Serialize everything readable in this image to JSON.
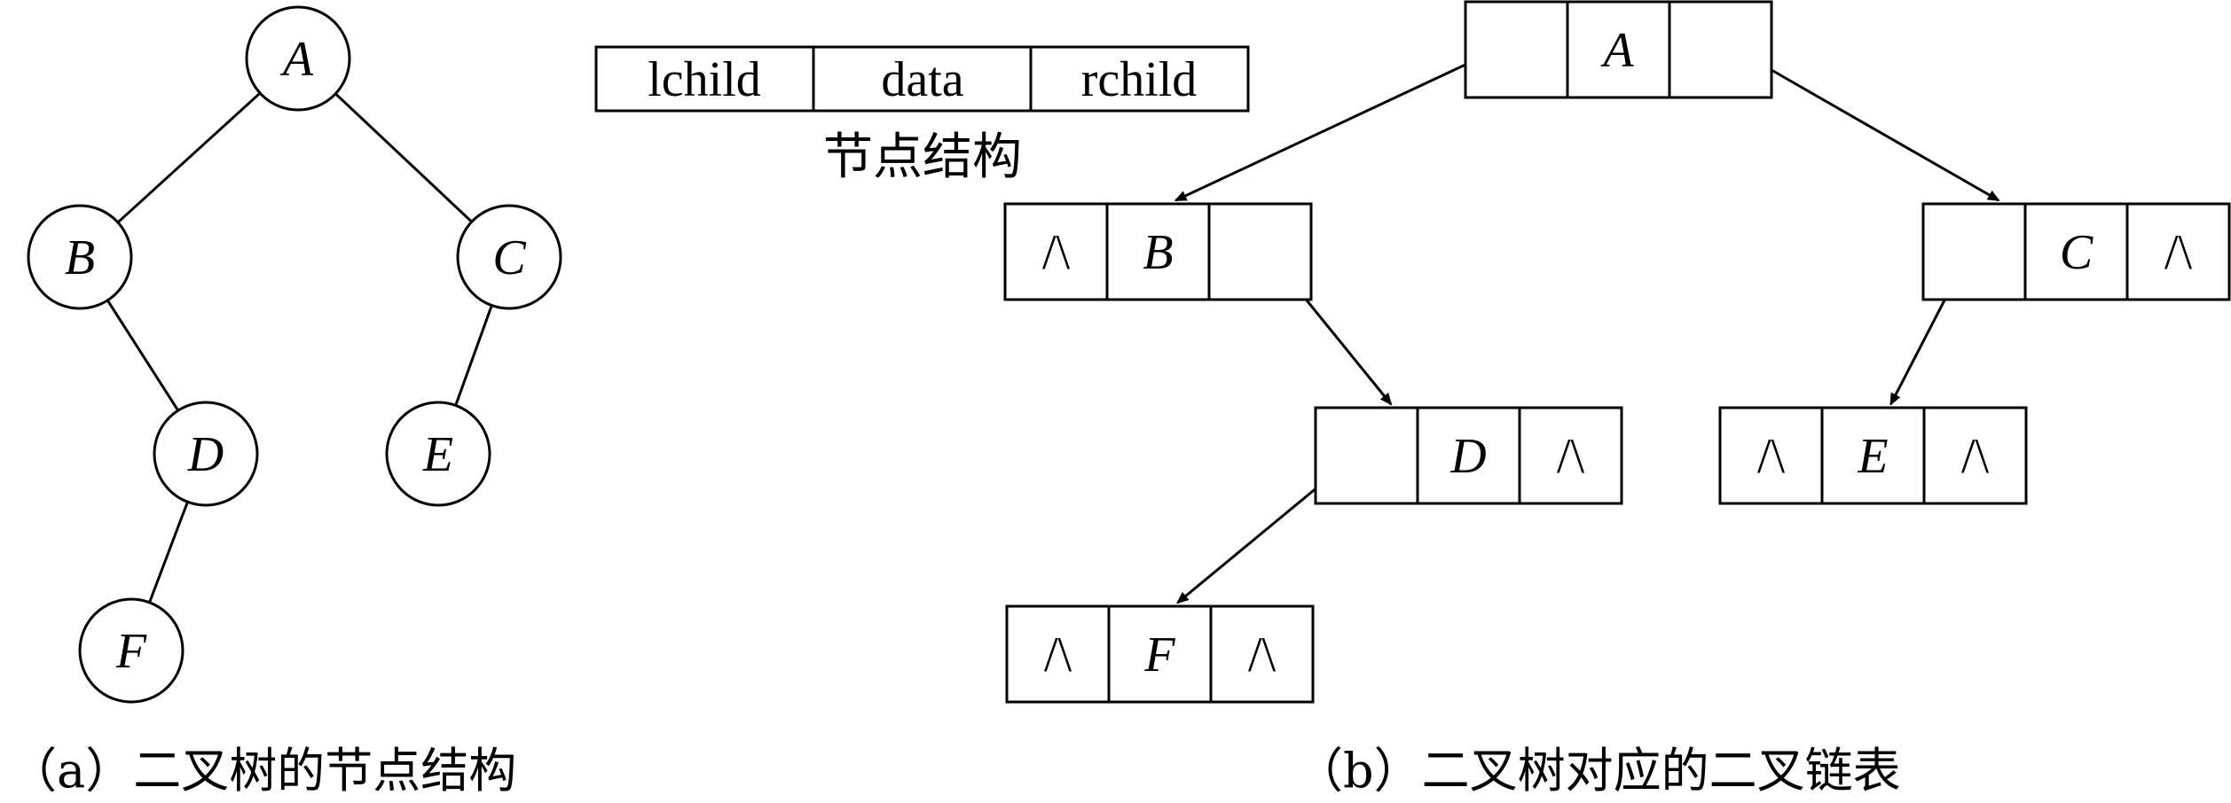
{
  "tree": {
    "nodes": [
      {
        "id": "A",
        "label": "A"
      },
      {
        "id": "B",
        "label": "B"
      },
      {
        "id": "C",
        "label": "C"
      },
      {
        "id": "D",
        "label": "D"
      },
      {
        "id": "E",
        "label": "E"
      },
      {
        "id": "F",
        "label": "F"
      }
    ],
    "edges": [
      [
        "A",
        "B"
      ],
      [
        "A",
        "C"
      ],
      [
        "B",
        "D"
      ],
      [
        "C",
        "E"
      ],
      [
        "D",
        "F"
      ]
    ]
  },
  "node_structure": {
    "fields": [
      "lchild",
      "data",
      "rchild"
    ],
    "label": "节点结构"
  },
  "linked_list": {
    "nodes": [
      {
        "id": "A",
        "left": "",
        "data": "A",
        "right": ""
      },
      {
        "id": "B",
        "left": "/\\",
        "data": "B",
        "right": ""
      },
      {
        "id": "C",
        "left": "",
        "data": "C",
        "right": "/\\"
      },
      {
        "id": "D",
        "left": "",
        "data": "D",
        "right": "/\\"
      },
      {
        "id": "E",
        "left": "/\\",
        "data": "E",
        "right": "/\\"
      },
      {
        "id": "F",
        "left": "/\\",
        "data": "F",
        "right": "/\\"
      }
    ],
    "links": [
      {
        "from": "A",
        "side": "left",
        "to": "B"
      },
      {
        "from": "A",
        "side": "right",
        "to": "C"
      },
      {
        "from": "B",
        "side": "right",
        "to": "D"
      },
      {
        "from": "C",
        "side": "left",
        "to": "E"
      },
      {
        "from": "D",
        "side": "left",
        "to": "F"
      }
    ]
  },
  "captions": {
    "a": "（a）二叉树的节点结构",
    "b": "（b）二叉树对应的二叉链表"
  }
}
